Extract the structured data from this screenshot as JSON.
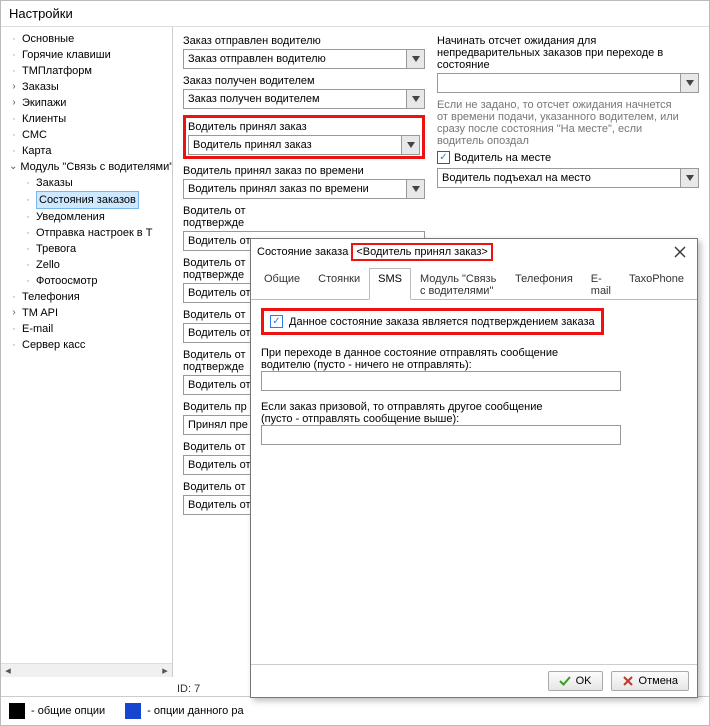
{
  "window_title": "Настройки",
  "tree": {
    "items": [
      {
        "label": "Основные",
        "leaf": true
      },
      {
        "label": "Горячие клавиши",
        "leaf": true
      },
      {
        "label": "ТМПлатформ",
        "leaf": true
      },
      {
        "label": "Заказы",
        "expand": "+"
      },
      {
        "label": "Экипажи",
        "expand": "+"
      },
      {
        "label": "Клиенты",
        "leaf": true
      },
      {
        "label": "СМС",
        "leaf": true
      },
      {
        "label": "Карта",
        "leaf": true
      },
      {
        "label": "Модуль \"Связь с водителями\"",
        "expand": "-",
        "children": [
          {
            "label": "Заказы"
          },
          {
            "label": "Состояния заказов",
            "selected": true
          },
          {
            "label": "Уведомления"
          },
          {
            "label": "Отправка настроек в Т"
          },
          {
            "label": "Тревога"
          },
          {
            "label": "Zello"
          },
          {
            "label": "Фотоосмотр"
          }
        ]
      },
      {
        "label": "Телефония",
        "leaf": true
      },
      {
        "label": "TM API",
        "expand": "+"
      },
      {
        "label": "E-mail",
        "leaf": true
      },
      {
        "label": "Сервер касс",
        "leaf": true
      }
    ]
  },
  "left": {
    "l1": "Заказ отправлен водителю",
    "v1": "Заказ отправлен водителю",
    "l2": "Заказ получен водителем",
    "v2": "Заказ получен водителем",
    "l3": "Водитель принял заказ",
    "v3": "Водитель принял заказ",
    "l4": "Водитель принял заказ по времени",
    "v4": "Водитель принял заказ по времени",
    "l5": "Водитель от",
    "l5b": "подтвержде",
    "v5": "Водитель от",
    "l6": "Водитель от",
    "l6b": "подтвержде",
    "v6": "Водитель от",
    "l7": "Водитель от",
    "v7": "Водитель от",
    "l8": "Водитель от",
    "l8b": "подтвержде",
    "v8": "Водитель от",
    "l9": "Водитель пр",
    "v9": "Принял пре",
    "l10": "Водитель от",
    "v10": "Водитель от",
    "l11": "Водитель от",
    "v11": "Водитель от"
  },
  "right": {
    "l1a": "Начинать отсчет ожидания для",
    "l1b": "непредварительных заказов при переходе в",
    "l1c": "состояние",
    "hint1": "Если не задано, то отсчет ожидания начнется",
    "hint2": "от времени подачи, указанного водителем, или",
    "hint3": "сразу после состояния \"На месте\", если",
    "hint4": "водитель опоздал",
    "chk1": "Водитель на месте",
    "v2": "Водитель подъехал на место"
  },
  "dialog": {
    "title_prefix": "Состояние заказа ",
    "title_hl": "<Водитель принял заказ>",
    "tabs": [
      "Общие",
      "Стоянки",
      "SMS",
      "Модуль \"Связь с водителями\"",
      "Телефония",
      "E-mail",
      "TaxoPhone"
    ],
    "active_tab": 2,
    "confirm_label": "Данное состояние заказа является подтверждением заказа",
    "p1a": "При переходе в данное состояние отправлять сообщение",
    "p1b": "водителю (пусто - ничего не отправлять):",
    "p2a": "Если заказ призовой, то отправлять другое сообщение",
    "p2b": "(пусто - отправлять сообщение выше):",
    "ok": "OK",
    "cancel": "Отмена"
  },
  "legend": {
    "t1": "- общие опции",
    "t2": "- опции данного ра"
  },
  "status": {
    "id_label": "ID: 7"
  }
}
